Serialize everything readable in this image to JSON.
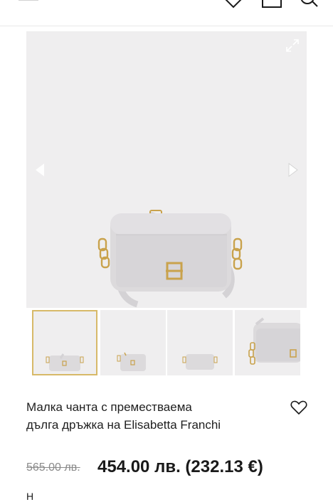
{
  "colors": {
    "accent_gold": "#d7b968",
    "gallery_bg": "#efeeef",
    "bag": "#d9d7d9",
    "hardware": "#c9a24c",
    "old_price": "#8a8a8a"
  },
  "icons": {
    "menu": "hamburger-icon",
    "wishlist": "heart-icon",
    "cart": "bag-icon",
    "search": "search-icon",
    "expand": "expand-icon",
    "prev": "chevron-left-icon",
    "next": "chevron-right-icon"
  },
  "gallery": {
    "active_thumbnail": 1,
    "thumbnail_count": 4
  },
  "product": {
    "title_line1": "Малка чанта с преместваема",
    "title_line2": "дълга дръжка на Elisabetta Franchi",
    "old_price": "565.00 лв.",
    "price": "454.00 лв. (232.13 €)"
  },
  "below_fold_text": "Н"
}
